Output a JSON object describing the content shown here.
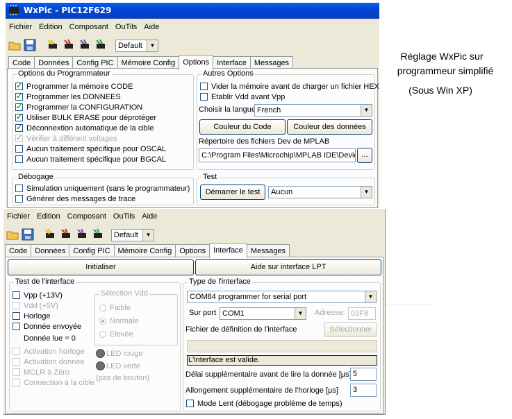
{
  "window1": {
    "title": "WxPic - PIC12F629",
    "menu": [
      "Fichier",
      "Edition",
      "Composant",
      "OuTils",
      "Aide"
    ],
    "toolbar": {
      "device_combo": "Default"
    },
    "tabs": [
      "Code",
      "Données",
      "Config PIC",
      "Mémoire Config",
      "Options",
      "Interface",
      "Messages"
    ],
    "active_tab": "Options",
    "programmer_options": {
      "label": "Options du Programmateur",
      "items": [
        {
          "text": "Programmer la mémoire CODE",
          "checked": true,
          "enabled": true
        },
        {
          "text": "Programmer les DONNEES",
          "checked": true,
          "enabled": true
        },
        {
          "text": "Programmer la CONFIGURATION",
          "checked": true,
          "enabled": true
        },
        {
          "text": "Utiliser BULK ERASE pour déprotéger",
          "checked": true,
          "enabled": true
        },
        {
          "text": "Déconnextion automatique de la cible",
          "checked": true,
          "enabled": true
        },
        {
          "text": "Vérifier à différent voltages",
          "checked": true,
          "enabled": false
        },
        {
          "text": "Aucun traitement spécifique pour OSCAL",
          "checked": false,
          "enabled": true
        },
        {
          "text": "Aucun traitement spécifique pour BGCAL",
          "checked": false,
          "enabled": true
        }
      ]
    },
    "other_options": {
      "label": "Autres Options",
      "clear_memory": "Vider la mémoire avant de charger un fichier HEX",
      "vdd_before_vpp": "Etablir Vdd avant Vpp",
      "language_label": "Choisir la langue",
      "language_value": "French",
      "code_color_button": "Couleur du Code",
      "data_color_button": "Couleur des données",
      "mplab_dir_label": "Répertoire des fichiers Dev de MPLAB",
      "mplab_dir_value": "C:\\Program Files\\Microchip\\MPLAB IDE\\Device",
      "browse_button": "..."
    },
    "debug": {
      "label": "Débogage",
      "simulation": "Simulation uniquement (sans le programmateur)",
      "trace": "Générer des messages de trace"
    },
    "test": {
      "label": "Test",
      "start_button": "Démarrer le test",
      "select_value": "Aucun"
    }
  },
  "window2": {
    "menu": [
      "Fichier",
      "Edition",
      "Composant",
      "OuTils",
      "Aide"
    ],
    "toolbar": {
      "device_combo": "Default"
    },
    "tabs": [
      "Code",
      "Données",
      "Config PIC",
      "Mémoire Config",
      "Options",
      "Interface",
      "Messages"
    ],
    "active_tab": "Interface",
    "init_button": "Initialiser",
    "lpt_help_button": "Aide sur interface LPT",
    "interface_test": {
      "label": "Test de l'interface",
      "vpp": "Vpp (+13V)",
      "vdd": "Vdd (+5V)",
      "clock": "Horloge",
      "data_sent": "Donnée envoyée",
      "data_read": "Donnée lue = 0",
      "clock_activation": "Activation horloge",
      "data_activation": "Activation donnée",
      "mclr_zero": "MCLR à Zéro",
      "target_connection": "Connection à la cible",
      "vdd_selection_label": "Sélection Vdd",
      "vdd_low": "Faible",
      "vdd_normal": "Normale",
      "vdd_high": "Elevée",
      "led_red": "LED rouge",
      "led_green": "LED verte",
      "no_button": "(pas de bouton)"
    },
    "interface_type": {
      "label": "Type de l'interface",
      "type_value": "COM84 programmer for serial port",
      "port_label": "Sur port",
      "port_value": "COM1",
      "address_label": "Adresse:",
      "address_value": "03F8",
      "def_file_label": "Fichier de définition de l'interface",
      "select_button": "Sélectionner",
      "def_file_value": "",
      "status": "L'interface est valide.",
      "read_delay_label": "Délai supplémentaire avant de lire la donnée [µs]",
      "read_delay_value": "5",
      "clock_ext_label": "Allongement supplémentaire de l'horloge [µs]",
      "clock_ext_value": "3",
      "slow_mode": "Mode Lent (débogage problème de temps)"
    }
  },
  "annotation": {
    "line1": "Réglage   WxPic sur",
    "line2": "programmeur simplifié",
    "line3": "(Sous Win XP)"
  }
}
